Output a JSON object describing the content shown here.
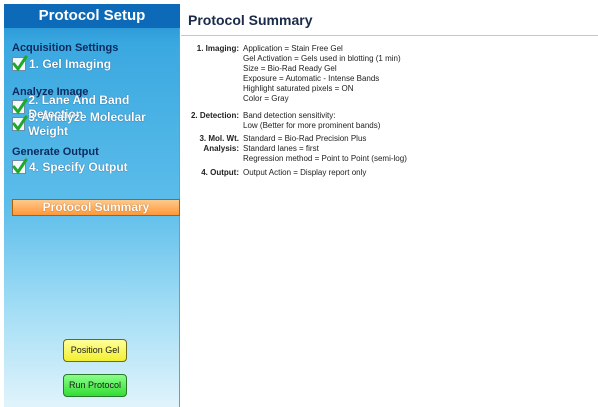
{
  "sidebar": {
    "title": "Protocol Setup",
    "sections": [
      {
        "label": "Acquisition Settings",
        "steps": [
          "1. Gel Imaging"
        ]
      },
      {
        "label": "Analyze Image",
        "steps": [
          "2. Lane And Band Detection",
          "3. Analyze Molecular Weight"
        ]
      },
      {
        "label": "Generate Output",
        "steps": [
          "4. Specify Output"
        ]
      }
    ],
    "summary_button": "Protocol Summary",
    "position_gel_button": "Position Gel",
    "run_protocol_button": "Run Protocol"
  },
  "main": {
    "title": "Protocol Summary",
    "items": [
      {
        "label": "1. Imaging:",
        "values": [
          "Application = Stain Free Gel",
          "Gel Activation = Gels used in blotting (1 min)",
          "Size = Bio-Rad Ready Gel",
          "Exposure = Automatic - Intense Bands",
          "Highlight saturated pixels = ON",
          "Color = Gray"
        ]
      },
      {
        "label": "2. Detection:",
        "values": [
          "Band detection sensitivity:",
          "Low (Better for more prominent bands)"
        ]
      },
      {
        "label_lines": [
          "3. Mol. Wt.",
          "Analysis:"
        ],
        "values": [
          "Standard = Bio-Rad Precision Plus",
          "Standard lanes = first",
          "Regression method = Point to Point (semi-log)"
        ]
      },
      {
        "label": "4. Output:",
        "values": [
          "Output Action = Display report only"
        ]
      }
    ]
  },
  "colors": {
    "sidebar_title_bg": "#0d6ab8",
    "summary_button_bg": "#ff9838",
    "position_gel_bg": "#f2ef30",
    "run_protocol_bg": "#33dd33"
  }
}
